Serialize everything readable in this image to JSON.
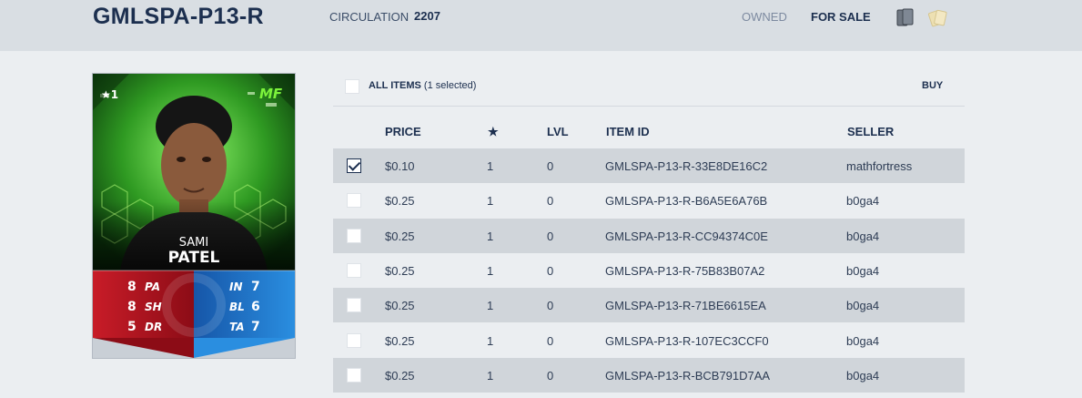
{
  "header": {
    "title": "GMLSPA-P13-R",
    "circulation_label": "CIRCULATION",
    "circulation_value": "2207",
    "tab_owned": "OWNED",
    "tab_for_sale": "FOR SALE",
    "view_icons": [
      "cards-stack-icon",
      "cards-fan-icon"
    ]
  },
  "card": {
    "star_level": "★1",
    "position": "MF",
    "first_name": "SAMI",
    "last_name": "PATEL",
    "left_stats": [
      {
        "value": "8",
        "abbr": "PA"
      },
      {
        "value": "8",
        "abbr": "SH"
      },
      {
        "value": "5",
        "abbr": "DR"
      }
    ],
    "right_stats": [
      {
        "abbr": "IN",
        "value": "7"
      },
      {
        "abbr": "BL",
        "value": "6"
      },
      {
        "abbr": "TA",
        "value": "7"
      }
    ],
    "colors": {
      "left_panel": "#b3121e",
      "right_panel": "#1a73c6",
      "accent": "#7cf33b"
    }
  },
  "list": {
    "all_items_label": "ALL ITEMS",
    "selected_count": "(1 selected)",
    "buy_label": "BUY",
    "columns": [
      "PRICE",
      "★",
      "LVL",
      "ITEM ID",
      "SELLER"
    ],
    "rows": [
      {
        "checked": true,
        "price": "$0.10",
        "star": "1",
        "lvl": "0",
        "item_id": "GMLSPA-P13-R-33E8DE16C2",
        "seller": "mathfortress"
      },
      {
        "checked": false,
        "price": "$0.25",
        "star": "1",
        "lvl": "0",
        "item_id": "GMLSPA-P13-R-B6A5E6A76B",
        "seller": "b0ga4"
      },
      {
        "checked": false,
        "price": "$0.25",
        "star": "1",
        "lvl": "0",
        "item_id": "GMLSPA-P13-R-CC94374C0E",
        "seller": "b0ga4"
      },
      {
        "checked": false,
        "price": "$0.25",
        "star": "1",
        "lvl": "0",
        "item_id": "GMLSPA-P13-R-75B83B07A2",
        "seller": "b0ga4"
      },
      {
        "checked": false,
        "price": "$0.25",
        "star": "1",
        "lvl": "0",
        "item_id": "GMLSPA-P13-R-71BE6615EA",
        "seller": "b0ga4"
      },
      {
        "checked": false,
        "price": "$0.25",
        "star": "1",
        "lvl": "0",
        "item_id": "GMLSPA-P13-R-107EC3CCF0",
        "seller": "b0ga4"
      },
      {
        "checked": false,
        "price": "$0.25",
        "star": "1",
        "lvl": "0",
        "item_id": "GMLSPA-P13-R-BCB791D7AA",
        "seller": "b0ga4"
      }
    ]
  }
}
